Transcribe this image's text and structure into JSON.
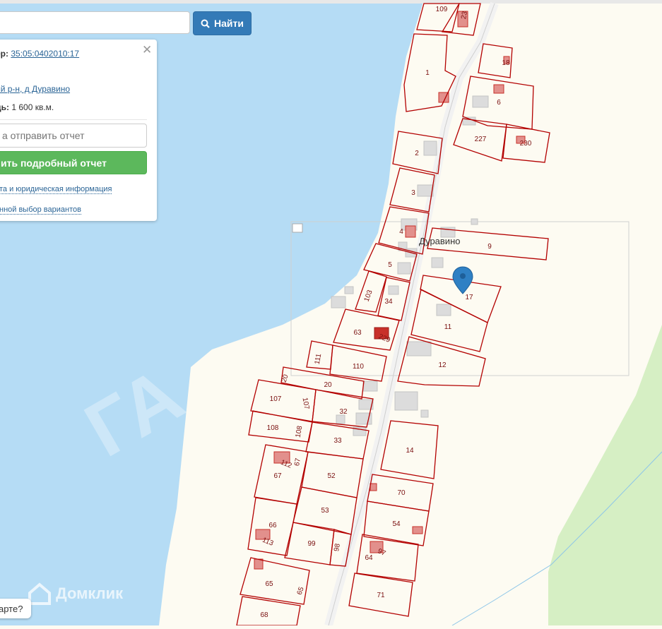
{
  "search": {
    "value": "",
    "button_label": "Найти"
  },
  "info_panel": {
    "cadastral_label": "ер:",
    "cadastral_number": "35:05:0402010:17",
    "address_link": "ий р-н, д Дуравино",
    "area_label": "дь:",
    "area_value": "1 600 кв.м.",
    "email_placeholder": "а отправить отчет",
    "report_button": "ить подробный отчет",
    "link_legal": "та и юридическая информация",
    "link_variants": "нной выбор вариантов"
  },
  "map": {
    "place_name": "Дуравино",
    "watermark": "Домклик",
    "big_watermark": "ГА",
    "help_bubble": "арте?",
    "colors": {
      "water": "#b5dcf5",
      "land": "#fdfbf2",
      "road": "#f4f4f4",
      "parcel_border": "#b30000",
      "forest": "#d6efc4",
      "building": "#e2908c",
      "building_dark": "#c8302a"
    },
    "parcels": [
      {
        "label": "109"
      },
      {
        "label": "23"
      },
      {
        "label": "1"
      },
      {
        "label": "18"
      },
      {
        "label": "6"
      },
      {
        "label": "227"
      },
      {
        "label": "230"
      },
      {
        "label": "2"
      },
      {
        "label": "3"
      },
      {
        "label": "4"
      },
      {
        "label": "9"
      },
      {
        "label": "5"
      },
      {
        "label": "103"
      },
      {
        "label": "34"
      },
      {
        "label": "17"
      },
      {
        "label": "11"
      },
      {
        "label": "63"
      },
      {
        "label": "229"
      },
      {
        "label": "111"
      },
      {
        "label": "110"
      },
      {
        "label": "12"
      },
      {
        "label": "20"
      },
      {
        "label": "20"
      },
      {
        "label": "107"
      },
      {
        "label": "107"
      },
      {
        "label": "32"
      },
      {
        "label": "108"
      },
      {
        "label": "108"
      },
      {
        "label": "33"
      },
      {
        "label": "14"
      },
      {
        "label": "112"
      },
      {
        "label": "67"
      },
      {
        "label": "67"
      },
      {
        "label": "52"
      },
      {
        "label": "70"
      },
      {
        "label": "53"
      },
      {
        "label": "54"
      },
      {
        "label": "66"
      },
      {
        "label": "113"
      },
      {
        "label": "99"
      },
      {
        "label": "98"
      },
      {
        "label": "64"
      },
      {
        "label": "97"
      },
      {
        "label": "65"
      },
      {
        "label": "65"
      },
      {
        "label": "71"
      },
      {
        "label": "68"
      }
    ]
  }
}
